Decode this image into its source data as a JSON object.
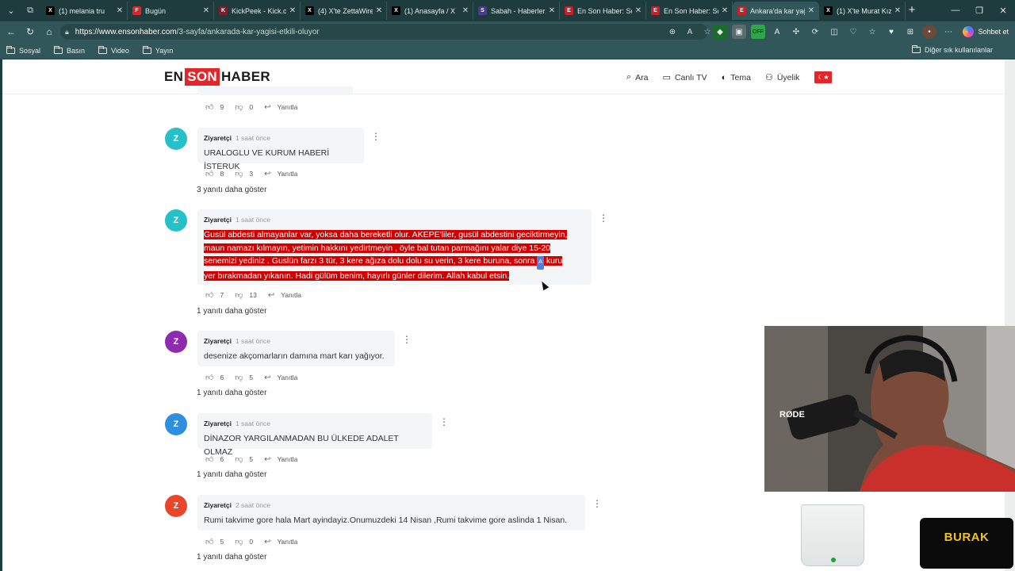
{
  "browser": {
    "tabs": [
      {
        "title": "(1) melania tru",
        "favicon": "X",
        "color": "#000000",
        "active": false
      },
      {
        "title": "Bugün",
        "favicon": "F",
        "color": "#d9232e",
        "active": false
      },
      {
        "title": "KickPeek - Kick.com",
        "favicon": "K",
        "color": "#7a1f2c",
        "active": false
      },
      {
        "title": "(4) X'te ZettaWire: \"",
        "favicon": "X",
        "color": "#000000",
        "active": false
      },
      {
        "title": "(1) Anasayfa / X",
        "favicon": "X",
        "color": "#000000",
        "active": false
      },
      {
        "title": "Sabah - Haberler, Son",
        "favicon": "S",
        "color": "#4a3b8f",
        "active": false
      },
      {
        "title": "En Son Haber: Son D",
        "favicon": "E",
        "color": "#c62026",
        "active": false
      },
      {
        "title": "En Son Haber: Son D",
        "favicon": "E",
        "color": "#c62026",
        "active": false
      },
      {
        "title": "Ankara'da kar yağışı",
        "favicon": "E",
        "color": "#c62026",
        "active": true
      },
      {
        "title": "(1) X'te Murat Kızılk",
        "favicon": "X",
        "color": "#000000",
        "active": false
      }
    ],
    "url_host": "https://www.ensonhaber.com",
    "url_path": "/3-sayfa/ankarada-kar-yagisi-etkili-oluyor",
    "chat_label": "Sohbet et",
    "bookmarks": [
      "Sosyal",
      "Basın",
      "Video",
      "Yayın"
    ],
    "bookmarks_other": "Diğer sık kullanılanlar"
  },
  "site": {
    "logo_en": "EN",
    "logo_son": "SON",
    "logo_haber": "HABER",
    "menu": {
      "search": "Ara",
      "live_tv": "Canlı TV",
      "theme": "Tema",
      "membership": "Üyelik"
    }
  },
  "top_partial": {
    "likes": "9",
    "dislikes": "0",
    "reply": "Yanıtla"
  },
  "comments": [
    {
      "avatar": "Z",
      "avatar_color": "#26c0c9",
      "author": "Ziyaretçi",
      "time": "1 saat önce",
      "text": "URALOGLU VE KURUM HABERİ İSTERUK",
      "likes": "8",
      "dislikes": "3",
      "reply": "Yanıtla",
      "more_replies": "3 yanıtı daha göster"
    },
    {
      "avatar": "Z",
      "avatar_color": "#26c0c9",
      "author": "Ziyaretçi",
      "time": "1 saat önce",
      "text_lines": [
        "Gusül abdesti almayanlar var, yoksa daha bereketli olur. AKEPE'liler, gusül abdestini geciktirmeyin,",
        "maun namazı kılmayın, yetimin hakkını yedirtmeyin , öyle bal tutan parmağını yalar diye 15-20",
        "senemizi yediniz . Guslün farzı 3 tür, 3 kere ağıza dolu dolu su verin, 3 kere buruna, sonra",
        "kuru",
        "yer bırakmadan yıkanın. Hadi gülüm benim, hayırlı günler dilerim. Allah kabul etsin."
      ],
      "likes": "7",
      "dislikes": "13",
      "reply": "Yanıtla",
      "more_replies": "1 yanıtı daha göster"
    },
    {
      "avatar": "Z",
      "avatar_color": "#8e2bb0",
      "author": "Ziyaretçi",
      "time": "1 saat önce",
      "text": "desenize akçomarların damına mart karı yağıyor.",
      "likes": "6",
      "dislikes": "5",
      "reply": "Yanıtla",
      "more_replies": "1 yanıtı daha göster"
    },
    {
      "avatar": "Z",
      "avatar_color": "#2f8ee0",
      "author": "Ziyaretçi",
      "time": "1 saat önce",
      "text": "DİNAZOR YARGILANMADAN BU ÜLKEDE ADALET OLMAZ",
      "likes": "6",
      "dislikes": "5",
      "reply": "Yanıtla",
      "more_replies": "1 yanıtı daha göster"
    },
    {
      "avatar": "Z",
      "avatar_color": "#e8462a",
      "author": "Ziyaretçi",
      "time": "2 saat önce",
      "text": "Rumi takvime gore hala Mart ayindayiz.Onumuzdeki 14 Nisan ,Rumi takvime gore aslinda 1 Nisan.",
      "likes": "5",
      "dislikes": "0",
      "reply": "Yanıtla",
      "more_replies": "1 yanıtı daha göster"
    }
  ],
  "overlay": {
    "mic_brand": "RØDE",
    "streamer_name": "BURAK"
  }
}
